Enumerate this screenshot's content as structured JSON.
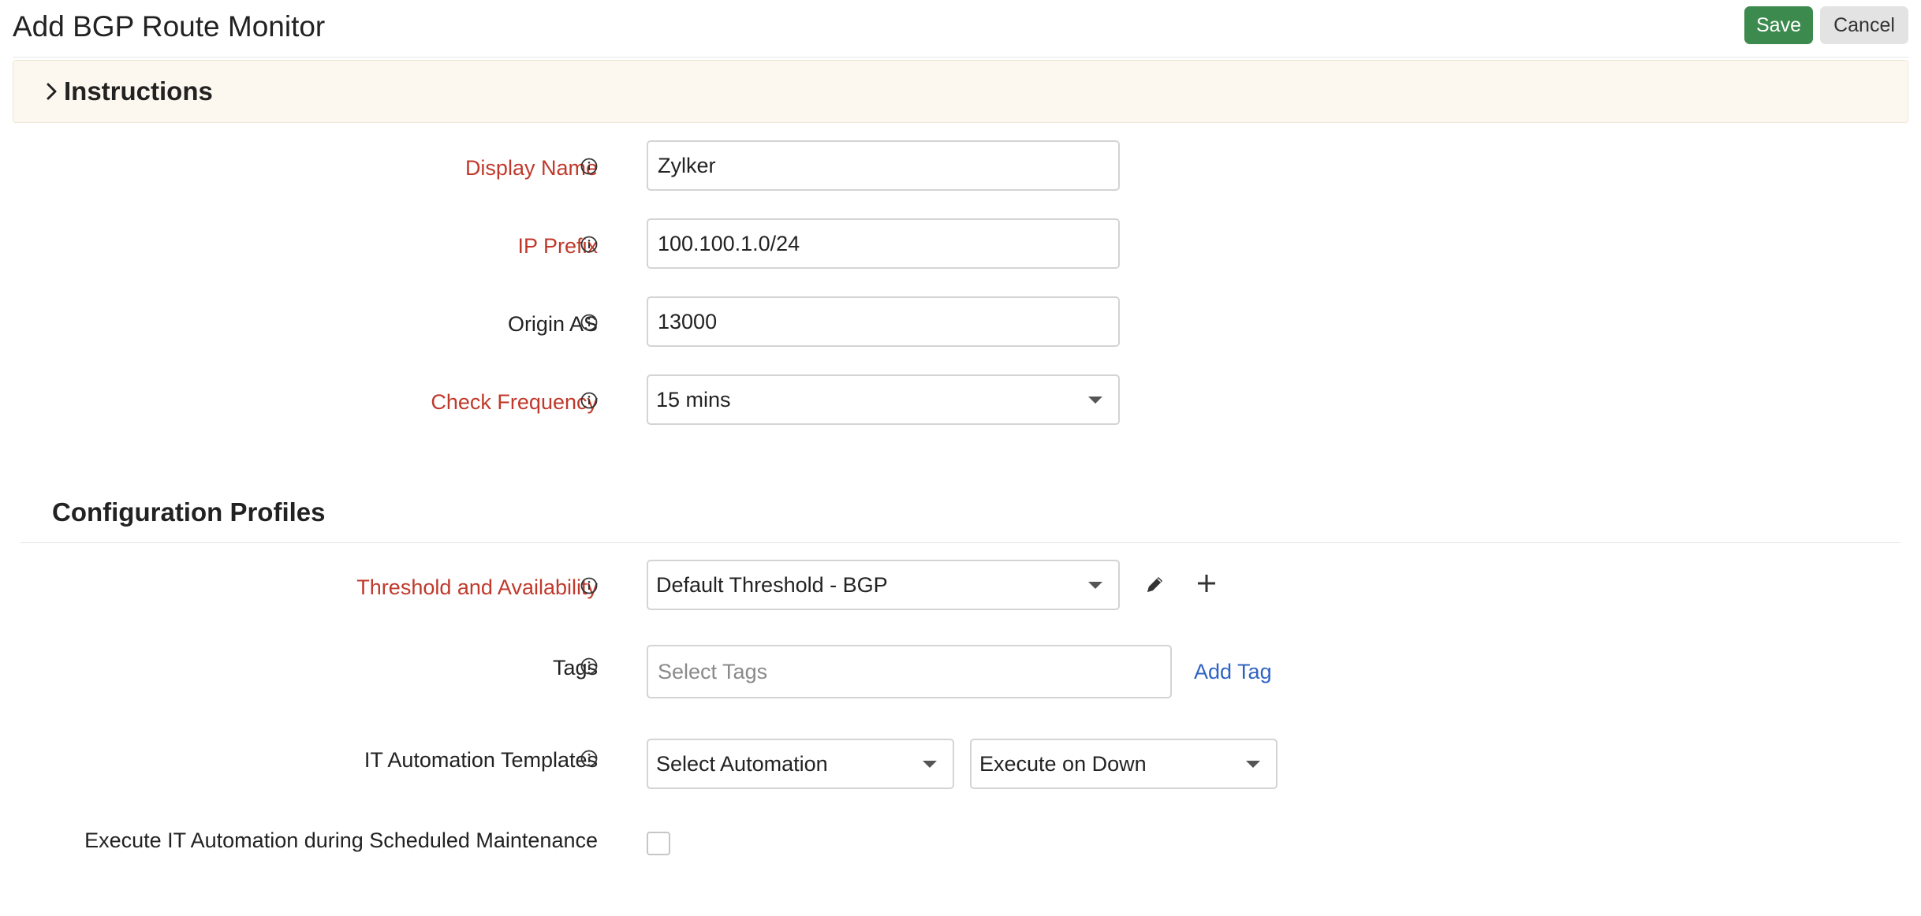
{
  "header": {
    "title": "Add BGP Route Monitor",
    "save_label": "Save",
    "cancel_label": "Cancel"
  },
  "instructions": {
    "label": "Instructions"
  },
  "form": {
    "display_name": {
      "label": "Display Name",
      "value": "Zylker"
    },
    "ip_prefix": {
      "label": "IP Prefix",
      "value": "100.100.1.0/24"
    },
    "origin_as": {
      "label": "Origin AS",
      "value": "13000"
    },
    "check_frequency": {
      "label": "Check Frequency",
      "value": "15 mins"
    }
  },
  "configuration_profiles": {
    "title": "Configuration Profiles",
    "threshold": {
      "label": "Threshold and Availability",
      "value": "Default Threshold - BGP"
    },
    "tags": {
      "label": "Tags",
      "placeholder": "Select Tags",
      "add_label": "Add Tag"
    },
    "automation": {
      "label": "IT Automation Templates",
      "template_value": "Select Automation",
      "execute_value": "Execute on Down"
    },
    "maintenance": {
      "label": "Execute IT Automation during Scheduled Maintenance",
      "checked": false
    }
  },
  "colors": {
    "required_label": "#c0392b",
    "save_button": "#3d8a4f",
    "link": "#2f63c3",
    "instructions_bg": "#fdf8ef"
  }
}
